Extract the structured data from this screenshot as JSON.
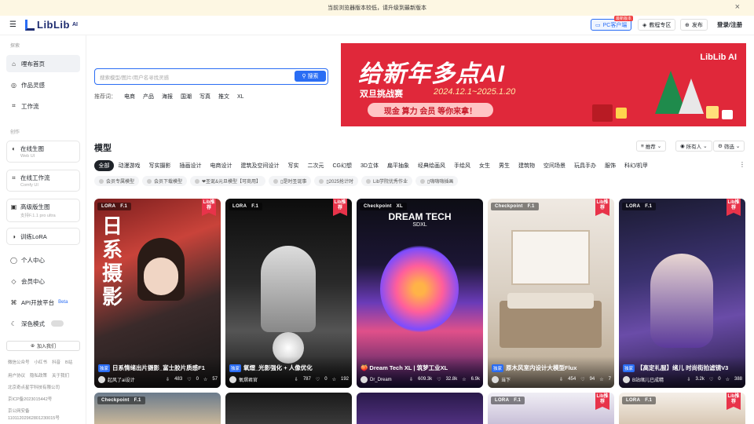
{
  "banner": {
    "text": "当前浏览器版本较低，请升级到最新版本",
    "close": "×"
  },
  "header": {
    "logo": "LibLib",
    "logo_ai": "AI",
    "pc_client": "PC客户端",
    "pc_badge": "最新版本",
    "tutorial": "教程专区",
    "publish": "发布",
    "login": "登录/注册"
  },
  "sidebar": {
    "explore_label": "探索",
    "create_label": "创作",
    "nav_home": "哩布首页",
    "nav_inspiration": "作品灵感",
    "nav_workflow": "工作流",
    "gen_online": {
      "title": "在线生图",
      "sub": "Web UI"
    },
    "workflow_online": {
      "title": "在线工作流",
      "sub": "Comfy UI"
    },
    "advanced_gen": {
      "title": "高级版生图",
      "sub": "支持F.1.1 pro ultra"
    },
    "train_lora": "训练LoRA",
    "personal": "个人中心",
    "member": "会员中心",
    "api": "API开放平台",
    "api_beta": "Beta",
    "dark_mode": "深色模式",
    "join_group": "加入我们",
    "footer_row1": [
      "微信公众号",
      "小红书",
      "抖音",
      "B站"
    ],
    "footer_row2": [
      "用户协议",
      "隐私政策",
      "关于我们"
    ],
    "company": "北京奇点星宇科技有限公司",
    "icp": "京ICP备2023015442号",
    "police": "京公网安备",
    "police_no": "11011202962801230015号"
  },
  "search": {
    "placeholder": "搜索模型/图片/用户名寻找灵感",
    "button": "搜索"
  },
  "hot_words": {
    "label": "推荐词：",
    "items": [
      "电商",
      "产品",
      "海报",
      "国潮",
      "写真",
      "推文",
      "XL"
    ]
  },
  "promo": {
    "title": "给新年多点AI",
    "subtitle": "双旦挑战赛",
    "dates": "2024.12.1~2025.1.20",
    "cta": "现金 算力 会员 等你来拿！",
    "logo": "LibLib AI"
  },
  "models": {
    "title": "模型",
    "sort": "推荐",
    "owner": "所有人",
    "filter": "筛选",
    "categories": [
      "全部",
      "动漫游戏",
      "写实摄影",
      "插画设计",
      "电商设计",
      "建筑及空间设计",
      "写实",
      "二次元",
      "CG幻想",
      "3D立体",
      "扁平抽象",
      "经典绘画风",
      "手绘风",
      "女生",
      "男生",
      "建筑物",
      "空间场景",
      "玩具手办",
      "服饰",
      "科幻/机甲"
    ],
    "more": "⋮",
    "tags": [
      "会员专属模型",
      "会员下载模型",
      "❤圣诞&元旦模型【可商用】",
      "▯是时圣诞事",
      "▯2025抢计时",
      "Lib学院优秀作业",
      "▯嗨嗨嗨插画"
    ]
  },
  "cards": [
    {
      "type": "LORA",
      "base": "F.1",
      "lib": true,
      "title": "日系情绪出片摄影_富士胶片质感F1",
      "author": "起风了ai设计",
      "downloads": "483",
      "likes": "0",
      "stars": "57",
      "art": "日系摄影"
    },
    {
      "type": "LORA",
      "base": "F.1",
      "lib": true,
      "title": "氧熠_光影强化 + 人像优化",
      "author": "氧熠君官",
      "downloads": "787",
      "likes": "0",
      "stars": "192",
      "art": ""
    },
    {
      "type": "Checkpoint",
      "base": "XL",
      "lib": false,
      "title": "🍑 Dream Tech XL | 筑梦工业XL",
      "author": "Dr_Dream",
      "downloads": "609.3k",
      "likes": "32.8k",
      "stars": "6.9k",
      "art": "DREAM TECH",
      "art_sub": "SDXL"
    },
    {
      "type": "Checkpoint",
      "base": "F.1",
      "lib": true,
      "title": "原木风室内设计大模型Flux",
      "author": "当下",
      "downloads": "454",
      "likes": "94",
      "stars": "7",
      "art": ""
    },
    {
      "type": "LORA",
      "base": "F.1",
      "lib": true,
      "title": "【高定礼服】绪儿 时尚街拍滤镜V3",
      "author": "B站绪儿已成精",
      "downloads": "3.2k",
      "likes": "0",
      "stars": "388",
      "art": ""
    }
  ],
  "cards_row2": [
    {
      "type": "Checkpoint",
      "base": "F.1"
    },
    {
      "type": "",
      "base": ""
    },
    {
      "type": "",
      "base": ""
    },
    {
      "type": "LORA",
      "base": "F.1",
      "lib": true
    },
    {
      "type": "LORA",
      "base": "F.1",
      "lib": true
    }
  ],
  "lib_ribbon": "Lib推荐",
  "rec_badge": "独家"
}
